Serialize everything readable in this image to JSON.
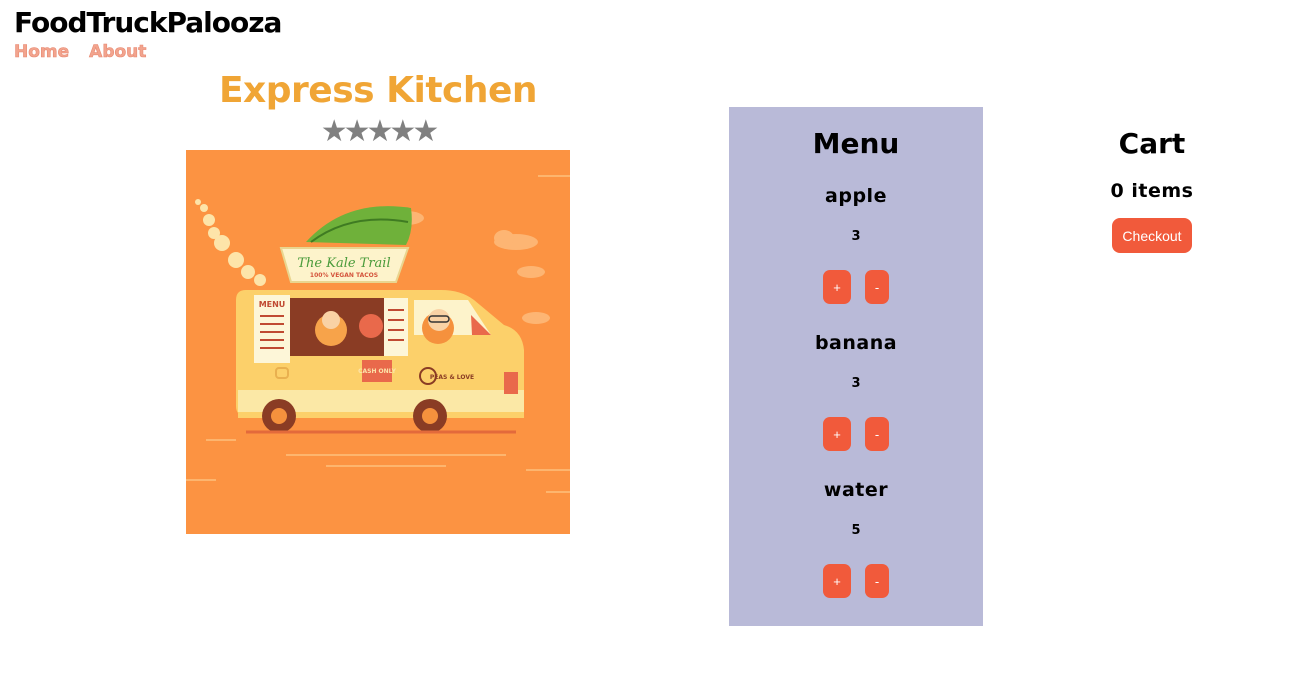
{
  "site": {
    "title": "FoodTruckPalooza"
  },
  "nav": {
    "home": "Home",
    "about": "About"
  },
  "truck": {
    "name": "Express Kitchen",
    "rating_stars": "★★★★★",
    "image_banner_line1": "The Kale Trail",
    "image_banner_line2": "100% VEGAN TACOS",
    "image_menu_label": "MENU",
    "image_sign_cash": "CASH ONLY",
    "image_sign_peas": "PEAS & LOVE"
  },
  "menu": {
    "title": "Menu",
    "items": [
      {
        "name": "apple",
        "price": "3",
        "plus": "+",
        "minus": "-"
      },
      {
        "name": "banana",
        "price": "3",
        "plus": "+",
        "minus": "-"
      },
      {
        "name": "water",
        "price": "5",
        "plus": "+",
        "minus": "-"
      }
    ]
  },
  "cart": {
    "title": "Cart",
    "count": "0 items",
    "checkout": "Checkout"
  },
  "colors": {
    "accent": "#f15a3b",
    "truck_name": "#f0a535",
    "menu_bg": "#b9bad8",
    "nav_link": "#f2a48e",
    "image_bg": "#fc9342"
  }
}
